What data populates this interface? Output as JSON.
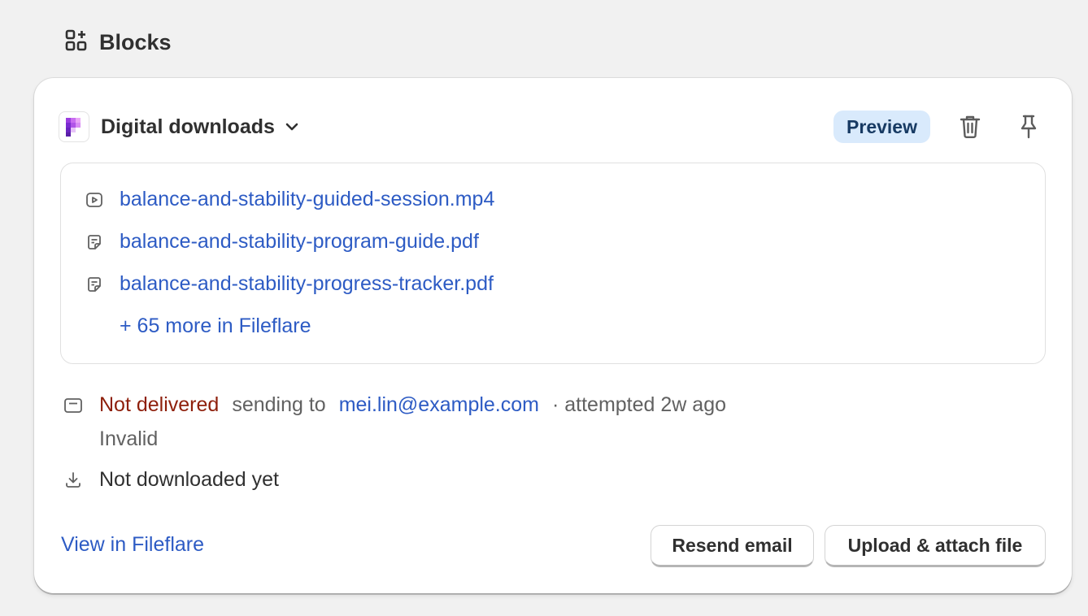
{
  "section": {
    "title": "Blocks",
    "icon": "blocks-add-icon"
  },
  "block": {
    "title": "Digital downloads",
    "badge": "Preview",
    "app_icon": "fileflare-logo",
    "files": [
      {
        "name": "balance-and-stability-guided-session.mp4",
        "icon": "video-file-icon"
      },
      {
        "name": "balance-and-stability-program-guide.pdf",
        "icon": "document-file-icon"
      },
      {
        "name": "balance-and-stability-progress-tracker.pdf",
        "icon": "document-file-icon"
      }
    ],
    "more_link": "+ 65 more in Fileflare",
    "delivery": {
      "status": "Not delivered",
      "sending_to": "sending to",
      "email": "mei.lin@example.com",
      "attempted": "· attempted 2w ago",
      "reason": "Invalid"
    },
    "download_status": "Not downloaded yet",
    "view_link": "View in Fileflare",
    "resend_button": "Resend email",
    "upload_button": "Upload & attach file"
  },
  "colors": {
    "link": "#2d5bc4",
    "error": "#8e1f0b",
    "badge_bg": "#d9eafc",
    "badge_text": "#173a63"
  }
}
